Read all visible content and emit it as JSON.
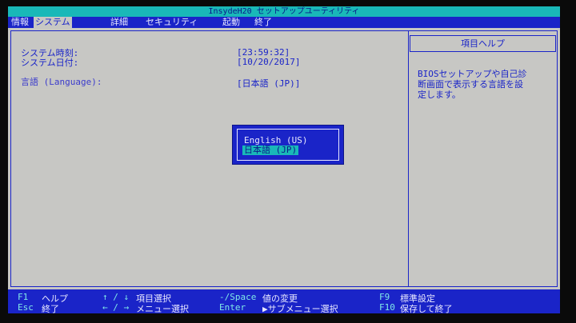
{
  "title": "InsydeH20 セットアップユーティリティ",
  "menu": [
    {
      "label": "情報"
    },
    {
      "label": "システム"
    },
    {
      "label": "詳細"
    },
    {
      "label": "セキュリティ"
    },
    {
      "label": "起動"
    },
    {
      "label": "終了"
    }
  ],
  "settings": {
    "time_label": "システム時刻:",
    "time_value": "[23:59:32]",
    "date_label": "システム日付:",
    "date_value": "[10/20/2017]",
    "language_label": "言語 (Language):",
    "language_value": "[日本語 (JP)]"
  },
  "popup": {
    "options": [
      "English (US)",
      "日本語 (JP)"
    ],
    "selected_index": 1
  },
  "help": {
    "title": "項目ヘルプ",
    "lines": [
      "BIOSセットアップや自己診",
      "断画面で表示する言語を設",
      "定します。"
    ]
  },
  "footer": {
    "row1": [
      {
        "key": "F1",
        "desc": "ヘルプ"
      },
      {
        "key": "↑ / ↓",
        "desc": "項目選択"
      },
      {
        "key": "-/Space",
        "desc": "値の変更"
      },
      {
        "key": "F9",
        "desc": "標準設定"
      }
    ],
    "row2": [
      {
        "key": "Esc",
        "desc": "終了"
      },
      {
        "key": "← / →",
        "desc": "メニュー選択"
      },
      {
        "key": "Enter",
        "desc": "▶サブメニュー選択"
      },
      {
        "key": "F10",
        "desc": "保存して終了"
      }
    ]
  }
}
